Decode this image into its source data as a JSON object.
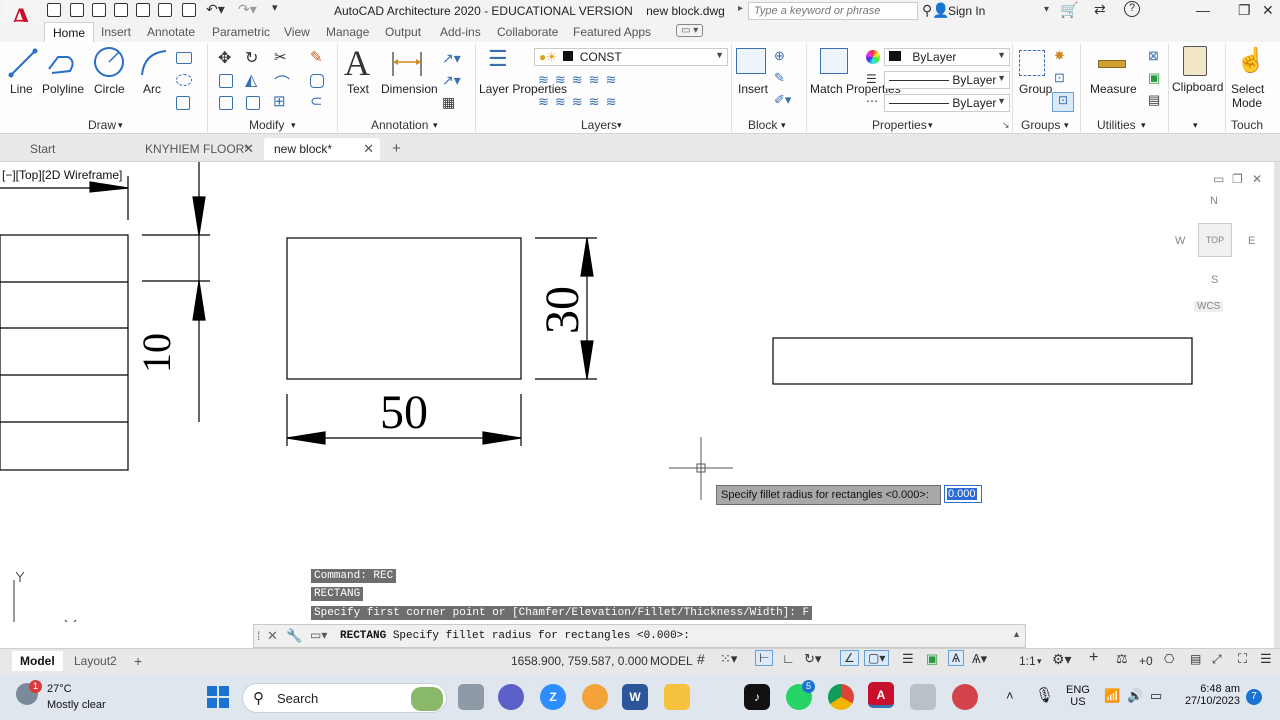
{
  "app": {
    "logo_letter": "A",
    "title": "AutoCAD Architecture 2020 - EDUCATIONAL VERSION    new block.dwg",
    "search_placeholder": "Type a keyword or phrase",
    "sign_in": "Sign In"
  },
  "ribbon_tabs": [
    "Home",
    "Insert",
    "Annotate",
    "Parametric",
    "View",
    "Manage",
    "Output",
    "Add-ins",
    "Collaborate",
    "Featured Apps"
  ],
  "ribbon": {
    "draw": {
      "title": "Draw",
      "tools": [
        "Line",
        "Polyline",
        "Circle",
        "Arc"
      ]
    },
    "modify": {
      "title": "Modify"
    },
    "annotation": {
      "title": "Annotation",
      "tools": [
        "Text",
        "Dimension"
      ]
    },
    "layers": {
      "title": "Layers",
      "tool": "Layer Properties",
      "current_layer": "CONST"
    },
    "block": {
      "title": "Block",
      "tool": "Insert"
    },
    "properties": {
      "title": "Properties",
      "tool": "Match Properties",
      "color": "ByLayer",
      "linetype": "ByLayer",
      "lineweight": "ByLayer"
    },
    "groups": {
      "title": "Groups",
      "tool": "Group"
    },
    "utilities": {
      "title": "Utilities",
      "tool": "Measure"
    },
    "clipboard": {
      "tool": "Clipboard"
    },
    "touch": {
      "title": "Touch",
      "tool": "Select Mode"
    }
  },
  "doc_tabs": [
    {
      "label": "Start"
    },
    {
      "label": "KNYHIEM FLOOR*"
    },
    {
      "label": "new block*"
    }
  ],
  "viewport": {
    "label": "[−][Top][2D Wireframe]",
    "viewcube": {
      "n": "N",
      "s": "S",
      "e": "E",
      "w": "W",
      "face": "TOP",
      "wcs": "WCS"
    }
  },
  "drawing": {
    "dim_width": "50",
    "dim_height": "30",
    "dim_left": "10"
  },
  "dynamic_input": {
    "prompt": "Specify fillet radius for rectangles <0.000>:",
    "value": "0.000"
  },
  "command_history": [
    "Command: REC",
    "RECTANG",
    "Specify first corner point or [Chamfer/Elevation/Fillet/Thickness/Width]: F"
  ],
  "command_line": {
    "command": "RECTANG",
    "text": " Specify fillet radius for rectangles <0.000>:"
  },
  "layout_tabs": [
    "Model",
    "Layout2"
  ],
  "status": {
    "coords": "1658.900, 759.587, 0.000",
    "space": "MODEL",
    "scale": "1:1",
    "plus_zero": "+0"
  },
  "taskbar": {
    "weather_temp": "27°C",
    "weather_desc": "Mostly clear",
    "weather_badge": "1",
    "search": "Search",
    "lang": "ENG",
    "region": "US",
    "time": "6:48 am",
    "date": "27/10/2023",
    "notif_count": "7",
    "whatsapp_badge": "5"
  },
  "colors": {
    "autocad_red": "#c8102e",
    "ribbon_bg": "#fdfdfd",
    "command_history_bg": "#6e6e6e",
    "input_highlight": "#2b6bd6"
  }
}
